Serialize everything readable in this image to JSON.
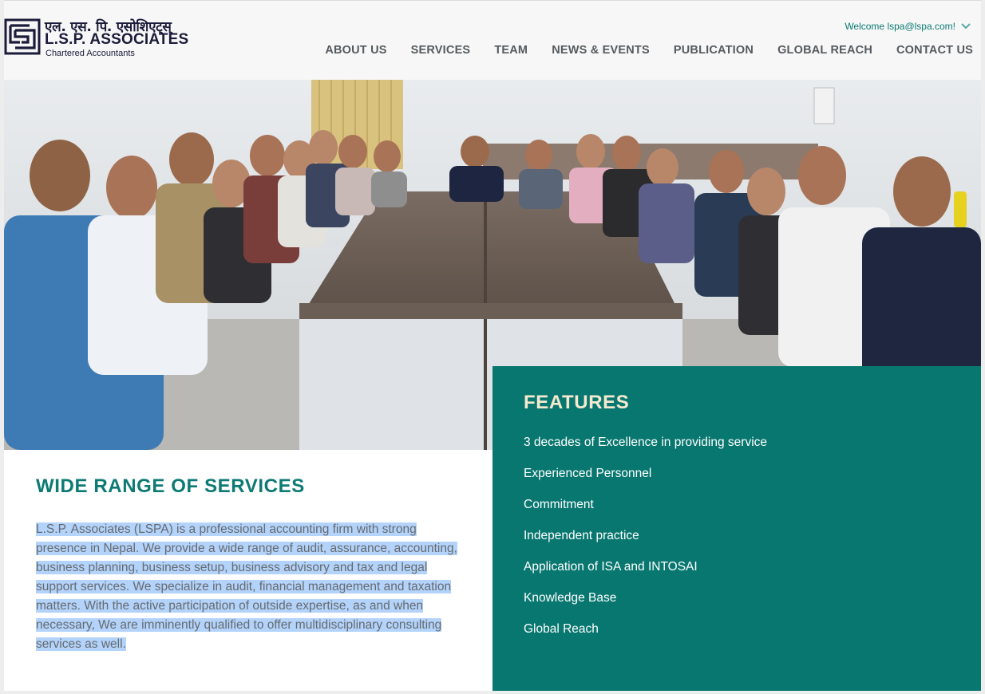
{
  "brand": {
    "devanagari": "एल. एस. पि. एसोशिएट्स्",
    "name": "L.S.P. ASSOCIATES",
    "tagline": "Chartered Accountants",
    "color": "#1b1b3a"
  },
  "header": {
    "welcome_text": "Welcome lspa@lspa.com!",
    "nav": [
      {
        "label": "ABOUT US"
      },
      {
        "label": "SERVICES"
      },
      {
        "label": "TEAM"
      },
      {
        "label": "NEWS & EVENTS"
      },
      {
        "label": "PUBLICATION"
      },
      {
        "label": "GLOBAL REACH"
      },
      {
        "label": "CONTACT US"
      }
    ]
  },
  "services": {
    "title": "WIDE RANGE OF SERVICES",
    "body": "L.S.P. Associates (LSPA) is a professional accounting firm with strong presence in Nepal.  We provide a wide range of audit, assurance, accounting, business planning, business setup, business advisory and tax and legal support services. We specialize in audit, financial management and taxation matters. With the active participation of outside expertise, as and when necessary, We are imminently qualified to offer multidisciplinary consulting services as well."
  },
  "features": {
    "title": "FEATURES",
    "items": [
      "3 decades of Excellence in providing service",
      "Experienced Personnel",
      "Commitment",
      "Independent practice",
      "Application of ISA and INTOSAI",
      "Knowledge Base",
      "Global Reach"
    ]
  },
  "colors": {
    "accent": "#087770",
    "heading_teal": "#0d7a73",
    "features_title": "#f5ead0",
    "selection": "#b3d3fb"
  },
  "icons": {
    "logo": "lspa-logo-icon",
    "dropdown": "chevron-down-icon"
  }
}
